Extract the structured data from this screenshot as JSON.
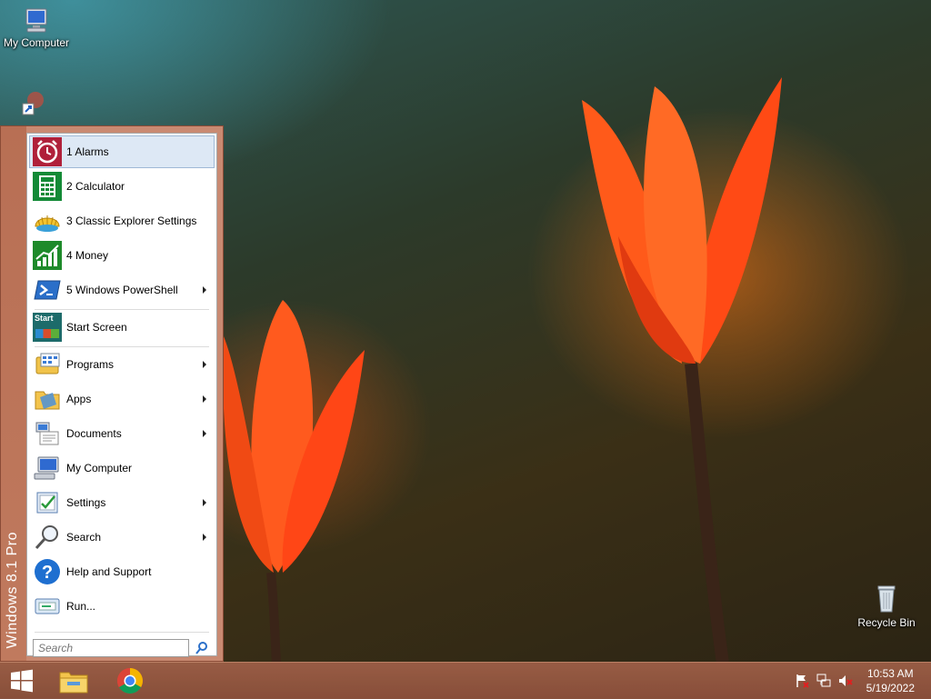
{
  "desktop": {
    "icons": [
      {
        "label": "My Computer",
        "icon": "my-computer-icon"
      },
      {
        "label": "Recycle Bin",
        "icon": "recycle-bin-icon"
      }
    ]
  },
  "start_menu": {
    "edition_label": "Windows 8.1 Pro",
    "recent": [
      {
        "label": "1 Alarms",
        "icon": "alarm-clock-icon",
        "selected": true
      },
      {
        "label": "2 Calculator",
        "icon": "calculator-icon"
      },
      {
        "label": "3 Classic Explorer Settings",
        "icon": "shell-icon"
      },
      {
        "label": "4 Money",
        "icon": "money-chart-icon"
      },
      {
        "label": "5 Windows PowerShell",
        "icon": "powershell-icon",
        "has_submenu": true
      }
    ],
    "start_screen": {
      "label": "Start Screen",
      "icon_text": "Start"
    },
    "items": [
      {
        "label": "Programs",
        "icon": "programs-icon",
        "has_submenu": true
      },
      {
        "label": "Apps",
        "icon": "apps-folder-icon",
        "has_submenu": true
      },
      {
        "label": "Documents",
        "icon": "documents-icon",
        "has_submenu": true
      },
      {
        "label": "My Computer",
        "icon": "computer-icon"
      },
      {
        "label": "Settings",
        "icon": "settings-icon",
        "has_submenu": true
      },
      {
        "label": "Search",
        "icon": "magnifier-icon",
        "has_submenu": true
      },
      {
        "label": "Help and Support",
        "icon": "help-icon"
      },
      {
        "label": "Run...",
        "icon": "run-icon"
      }
    ],
    "search": {
      "placeholder": "Search"
    }
  },
  "taskbar": {
    "buttons": [
      {
        "name": "start",
        "icon": "windows-logo-icon"
      },
      {
        "name": "file-explorer",
        "icon": "file-explorer-icon"
      },
      {
        "name": "chrome",
        "icon": "chrome-icon"
      }
    ],
    "tray": [
      "action-center-flag-icon",
      "network-icon",
      "volume-muted-icon"
    ],
    "clock": {
      "time": "10:53 AM",
      "date": "5/19/2022"
    }
  },
  "colors": {
    "accent": "#c07a5e",
    "menu_border": "#8a4b36",
    "selection": "#dde8f5"
  }
}
